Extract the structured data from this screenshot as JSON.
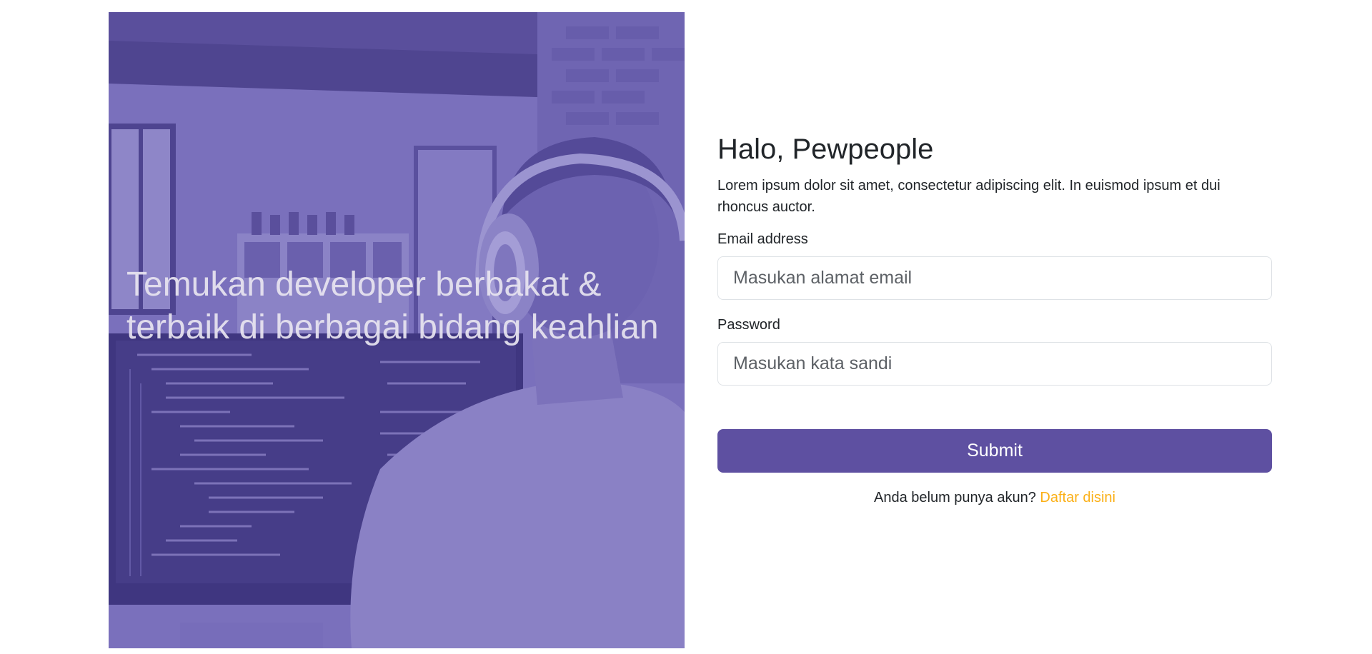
{
  "hero": {
    "title": "Temukan developer berbakat & terbaik di berbagai bidang keahlian",
    "overlay_color": "#6a5fae"
  },
  "form": {
    "greeting": "Halo, Pewpeople",
    "intro": "Lorem ipsum dolor sit amet, consectetur adipiscing elit. In euismod ipsum et dui rhoncus auctor.",
    "email_label": "Email address",
    "email_placeholder": "Masukan alamat email",
    "email_value": "",
    "password_label": "Password",
    "password_placeholder": "Masukan kata sandi",
    "password_value": "",
    "submit_label": "Submit",
    "signup_prompt": "Anda belum punya akun?",
    "signup_link": "Daftar disini"
  },
  "colors": {
    "primary": "#5e50a1",
    "link": "#fbb017",
    "text": "#212529",
    "input_border": "#dee2e6"
  }
}
